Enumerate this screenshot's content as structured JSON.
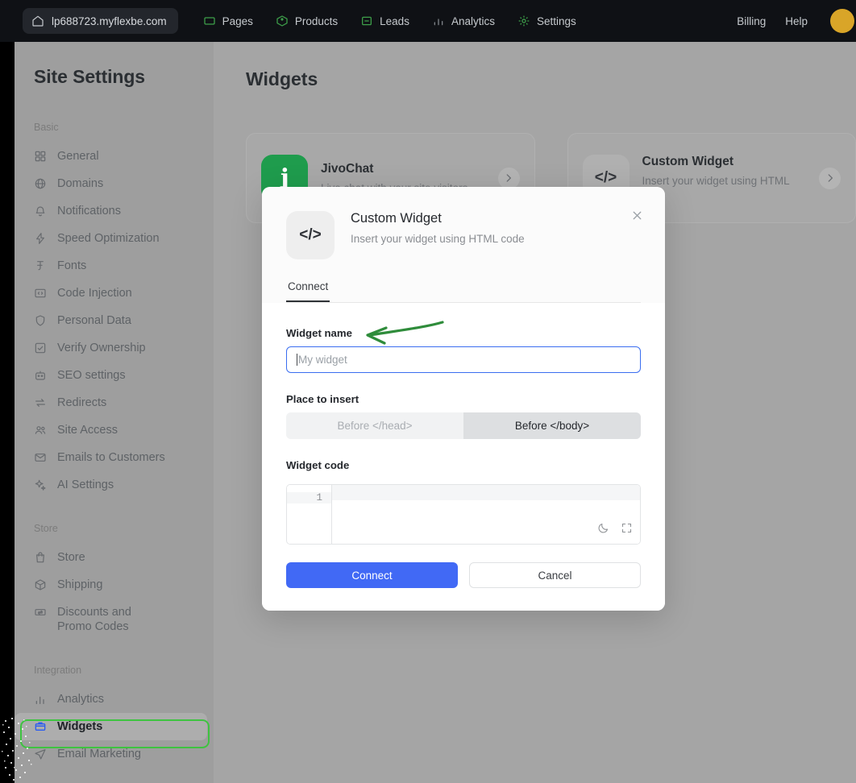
{
  "topbar": {
    "site_pill": {
      "icon": "home-icon",
      "label": "lp688723.myflexbe.com"
    },
    "nav": [
      {
        "icon": "pages-icon",
        "label": "Pages",
        "active": false
      },
      {
        "icon": "products-icon",
        "label": "Products",
        "active": false
      },
      {
        "icon": "leads-icon",
        "label": "Leads",
        "active": false
      },
      {
        "icon": "analytics-icon",
        "label": "Analytics",
        "active": false
      },
      {
        "icon": "gear-icon",
        "label": "Settings",
        "active": true
      }
    ],
    "billing_label": "Billing",
    "help_label": "Help",
    "avatar_color": "#d9a528"
  },
  "sidebar": {
    "title": "Site Settings",
    "groups": [
      {
        "label": "Basic",
        "items": [
          {
            "icon": "grid-icon",
            "label": "General"
          },
          {
            "icon": "globe-icon",
            "label": "Domains"
          },
          {
            "icon": "bell-icon",
            "label": "Notifications"
          },
          {
            "icon": "bolt-icon",
            "label": "Speed Optimization"
          },
          {
            "icon": "font-icon",
            "label": "Fonts"
          },
          {
            "icon": "code-box-icon",
            "label": "Code Injection"
          },
          {
            "icon": "shield-icon",
            "label": "Personal Data"
          },
          {
            "icon": "check-box-icon",
            "label": "Verify Ownership"
          },
          {
            "icon": "robot-icon",
            "label": "SEO settings"
          },
          {
            "icon": "redirect-icon",
            "label": "Redirects"
          },
          {
            "icon": "users-icon",
            "label": "Site Access"
          },
          {
            "icon": "mail-icon",
            "label": "Emails to Customers"
          },
          {
            "icon": "sparkle-icon",
            "label": "AI Settings"
          }
        ]
      },
      {
        "label": "Store",
        "items": [
          {
            "icon": "bag-icon",
            "label": "Store"
          },
          {
            "icon": "box-icon",
            "label": "Shipping"
          },
          {
            "icon": "ticket-icon",
            "label": "Discounts and Promo Codes"
          }
        ]
      },
      {
        "label": "Integration",
        "items": [
          {
            "icon": "bar-chart-icon",
            "label": "Analytics"
          },
          {
            "icon": "widgets-icon",
            "label": "Widgets",
            "active": true
          },
          {
            "icon": "send-icon",
            "label": "Email Marketing"
          }
        ]
      }
    ],
    "active_highlight_color": "#3ec340"
  },
  "main": {
    "page_title": "Widgets",
    "cards": [
      {
        "icon": "jivochat-logo",
        "icon_glyph": "ʝ",
        "name": "JivoChat",
        "description": "Live chat with your site visitors",
        "chevron": "chevron-right-icon"
      },
      {
        "icon": "code-icon",
        "icon_glyph": "</>",
        "name": "Custom Widget",
        "description": "Insert your widget using HTML code",
        "chevron": "chevron-right-icon"
      }
    ]
  },
  "modal": {
    "icon_glyph": "</>",
    "title": "Custom Widget",
    "subtitle": "Insert your widget using HTML code",
    "close_icon": "close-icon",
    "tabs": [
      {
        "label": "Connect",
        "active": true
      }
    ],
    "widget_name": {
      "label": "Widget name",
      "value": "",
      "placeholder": "My widget",
      "focused": true
    },
    "place_to_insert": {
      "label": "Place to insert",
      "options": [
        {
          "label": "Before </head>",
          "selected": false
        },
        {
          "label": "Before </body>",
          "selected": true
        }
      ]
    },
    "widget_code": {
      "label": "Widget code",
      "line_number": "1",
      "content": "",
      "tools": [
        "moon-icon",
        "fullscreen-icon"
      ]
    },
    "buttons": {
      "primary": "Connect",
      "secondary": "Cancel",
      "primary_color": "#4169f5"
    }
  },
  "annotation": {
    "arrow_color": "#2f8c3b",
    "points_to": "Widget name"
  }
}
